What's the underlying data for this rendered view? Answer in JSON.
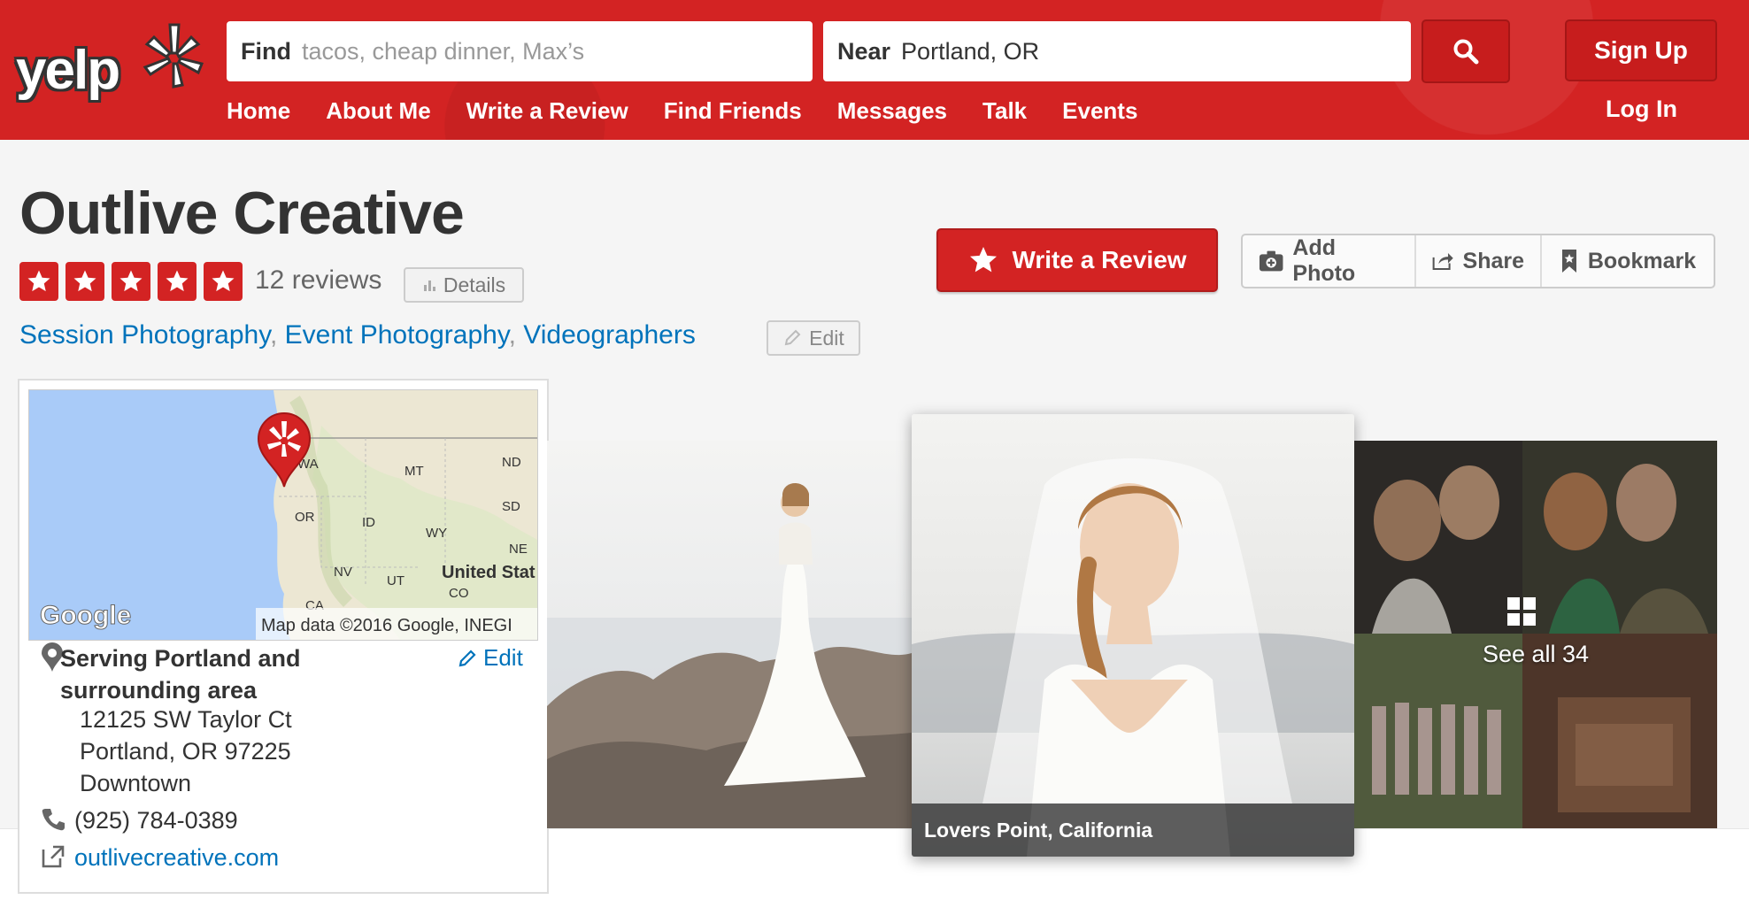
{
  "header": {
    "logo": "yelp",
    "search": {
      "find_label": "Find",
      "find_placeholder": "tacos, cheap dinner, Max’s",
      "near_label": "Near",
      "near_value": "Portland, OR"
    },
    "signup_label": "Sign Up",
    "login_label": "Log In",
    "nav": [
      "Home",
      "About Me",
      "Write a Review",
      "Find Friends",
      "Messages",
      "Talk",
      "Events"
    ]
  },
  "business": {
    "name": "Outlive Creative",
    "rating": 5,
    "review_count": "12 reviews",
    "details_label": "Details",
    "categories": [
      "Session Photography",
      "Event Photography",
      "Videographers"
    ],
    "category_edit_label": "Edit"
  },
  "actions": {
    "write_review": "Write a Review",
    "add_photo": "Add Photo",
    "share": "Share",
    "bookmark": "Bookmark"
  },
  "map": {
    "labels": [
      "WA",
      "MT",
      "ND",
      "SD",
      "OR",
      "ID",
      "WY",
      "NE",
      "NV",
      "UT",
      "CO",
      "CA",
      "United Stat"
    ],
    "google": "Google",
    "attribution": "Map data ©2016 Google, INEGI"
  },
  "info": {
    "serving": "Serving Portland and surrounding area",
    "address1": "12125 SW Taylor Ct",
    "address2": "Portland, OR 97225",
    "neighborhood": "Downtown",
    "phone": "(925) 784-0389",
    "website": "outlivecreative.com",
    "edit_label": "Edit"
  },
  "photos": {
    "main_caption": "Lovers Point, California",
    "see_all": "See all 34"
  },
  "colors": {
    "brand_red": "#d32323",
    "link_blue": "#0073bb"
  }
}
